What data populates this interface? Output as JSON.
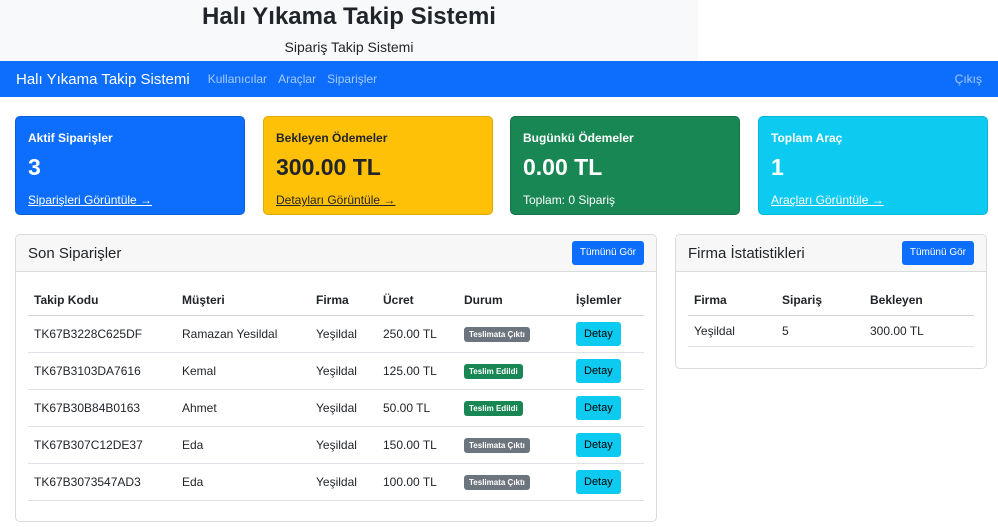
{
  "header": {
    "title": "Halı Yıkama Takip Sistemi",
    "subtitle": "Sipariş Takip Sistemi"
  },
  "navbar": {
    "brand": "Halı Yıkama Takip Sistemi",
    "links": [
      "Kullanıcılar",
      "Araçlar",
      "Siparişler"
    ],
    "logout": "Çıkış"
  },
  "cards": [
    {
      "label": "Aktif Siparişler",
      "value": "3",
      "link": "Siparişleri Görüntüle →"
    },
    {
      "label": "Bekleyen Ödemeler",
      "value": "300.00 TL",
      "link": "Detayları Görüntüle →"
    },
    {
      "label": "Bugünkü Ödemeler",
      "value": "0.00 TL",
      "note": "Toplam: 0 Sipariş"
    },
    {
      "label": "Toplam Araç",
      "value": "1",
      "link": "Araçları Görüntüle →"
    }
  ],
  "orders": {
    "title": "Son Siparişler",
    "button": "Tümünü Gör",
    "columns": [
      "Takip Kodu",
      "Müşteri",
      "Firma",
      "Ücret",
      "Durum",
      "İşlemler"
    ],
    "rows": [
      {
        "code": "TK67B3228C625DF",
        "customer": "Ramazan Yesildal",
        "firm": "Yeşildal",
        "fee": "250.00 TL",
        "status": "Teslimata Çıktı",
        "action": "Detay"
      },
      {
        "code": "TK67B3103DA7616",
        "customer": "Kemal",
        "firm": "Yeşildal",
        "fee": "125.00 TL",
        "status": "Teslim Edildi",
        "action": "Detay"
      },
      {
        "code": "TK67B30B84B0163",
        "customer": "Ahmet",
        "firm": "Yeşildal",
        "fee": "50.00 TL",
        "status": "Teslim Edildi",
        "action": "Detay"
      },
      {
        "code": "TK67B307C12DE37",
        "customer": "Eda",
        "firm": "Yeşildal",
        "fee": "150.00 TL",
        "status": "Teslimata Çıktı",
        "action": "Detay"
      },
      {
        "code": "TK67B3073547AD3",
        "customer": "Eda",
        "firm": "Yeşildal",
        "fee": "100.00 TL",
        "status": "Teslimata Çıktı",
        "action": "Detay"
      }
    ]
  },
  "firm_stats": {
    "title": "Firma İstatistikleri",
    "button": "Tümünü Gör",
    "columns": [
      "Firma",
      "Sipariş",
      "Bekleyen"
    ],
    "rows": [
      {
        "firm": "Yeşildal",
        "orders": "5",
        "pending": "300.00 TL"
      }
    ]
  },
  "colors": {
    "primary": "#0d6efd",
    "warning": "#ffc107",
    "success": "#198754",
    "info": "#0dcaf0",
    "secondary": "#6c757d"
  }
}
